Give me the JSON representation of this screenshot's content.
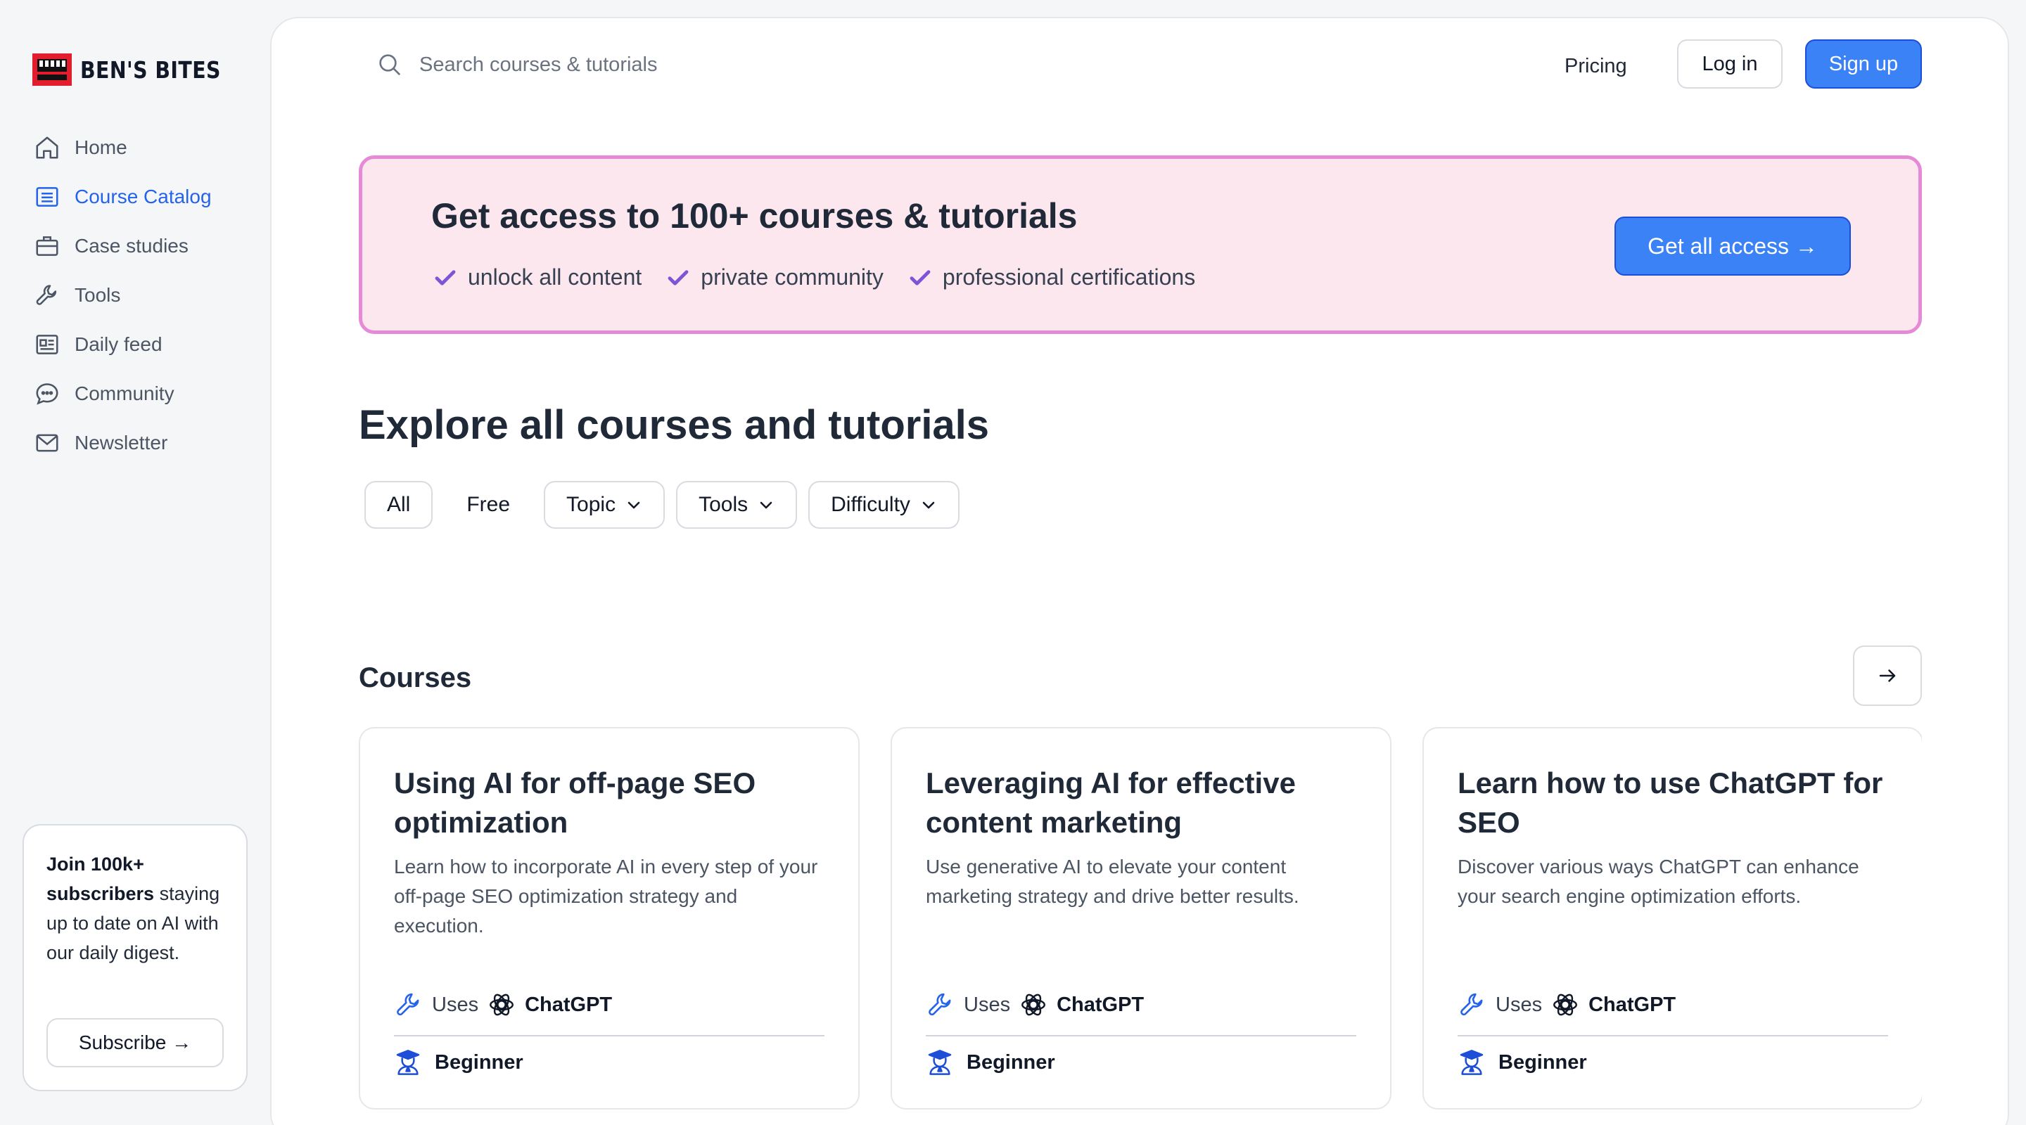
{
  "brand": {
    "name": "BEN'S BITES",
    "logo_color": "#e11d2e"
  },
  "colors": {
    "accent": "#3b82f6",
    "active_nav": "#2563eb",
    "banner_bg": "#fce7ef",
    "banner_border": "#e58ad6",
    "check": "#7c55d6"
  },
  "sidebar": {
    "items": [
      {
        "label": "Home",
        "icon": "home-icon"
      },
      {
        "label": "Course Catalog",
        "icon": "catalog-icon",
        "active": true
      },
      {
        "label": "Case studies",
        "icon": "briefcase-icon"
      },
      {
        "label": "Tools",
        "icon": "wrench-icon"
      },
      {
        "label": "Daily feed",
        "icon": "newspaper-icon"
      },
      {
        "label": "Community",
        "icon": "chat-bubble-icon"
      },
      {
        "label": "Newsletter",
        "icon": "mail-icon"
      }
    ],
    "promo": {
      "title": "Join 100k+ subscribers",
      "body": "staying up to date on AI with our daily digest.",
      "button": "Subscribe →"
    }
  },
  "header": {
    "search_placeholder": "Search courses & tutorials",
    "pricing": "Pricing",
    "login": "Log in",
    "signup": "Sign up"
  },
  "banner": {
    "title": "Get access to 100+ courses & tutorials",
    "perks": [
      "unlock all content",
      "private community",
      "professional certifications"
    ],
    "button": "Get all access →"
  },
  "explore": {
    "title": "Explore all courses and tutorials",
    "filters": {
      "all": "All",
      "free": "Free",
      "topic": "Topic",
      "tools": "Tools",
      "difficulty": "Difficulty"
    }
  },
  "courses": {
    "title": "Courses",
    "items": [
      {
        "title": "Using AI for off-page SEO optimization",
        "description": "Learn how to incorporate AI in every step of your off-page SEO optimization strategy and execution.",
        "uses_label": "Uses",
        "tool": "ChatGPT",
        "level": "Beginner"
      },
      {
        "title": "Leveraging AI for effective content marketing",
        "description": "Use generative AI to elevate your content marketing strategy and drive better results.",
        "uses_label": "Uses",
        "tool": "ChatGPT",
        "level": "Beginner"
      },
      {
        "title": "Learn how to use ChatGPT for SEO",
        "description": "Discover various ways ChatGPT can enhance your search engine optimization efforts.",
        "uses_label": "Uses",
        "tool": "ChatGPT",
        "level": "Beginner"
      }
    ]
  }
}
